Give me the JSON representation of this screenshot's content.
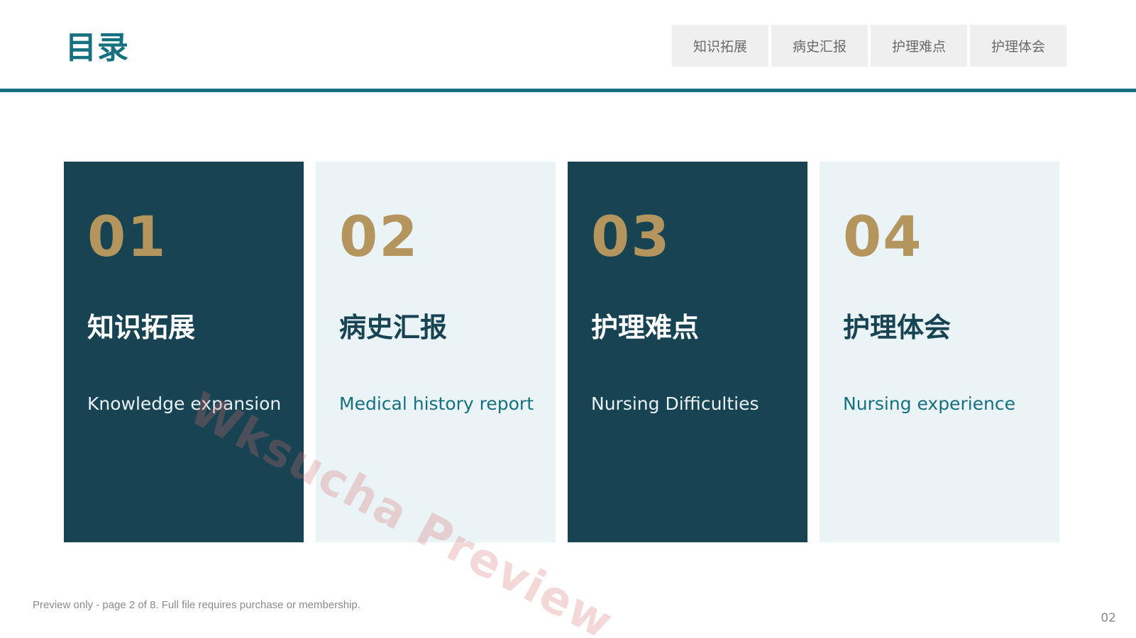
{
  "header": {
    "title": "目录",
    "nav": [
      "知识拓展",
      "病史汇报",
      "护理难点",
      "护理体会"
    ]
  },
  "cards": [
    {
      "number": "01",
      "title": "知识拓展",
      "subtitle": "Knowledge expansion",
      "style": "dark"
    },
    {
      "number": "02",
      "title": "病史汇报",
      "subtitle": "Medical history report",
      "style": "light"
    },
    {
      "number": "03",
      "title": "护理难点",
      "subtitle": "Nursing Difficulties",
      "style": "dark"
    },
    {
      "number": "04",
      "title": "护理体会",
      "subtitle": "Nursing experience",
      "style": "light"
    }
  ],
  "watermark": "Wksucha Preview",
  "footer": {
    "note": "Preview only - page 2 of 8. Full file requires purchase or membership.",
    "page_number": "02"
  },
  "colors": {
    "accent": "#17707f",
    "dark_card": "#174353",
    "light_card": "#eaf3f6",
    "number_gold": "#b3955d",
    "nav_bg": "#efefef"
  }
}
